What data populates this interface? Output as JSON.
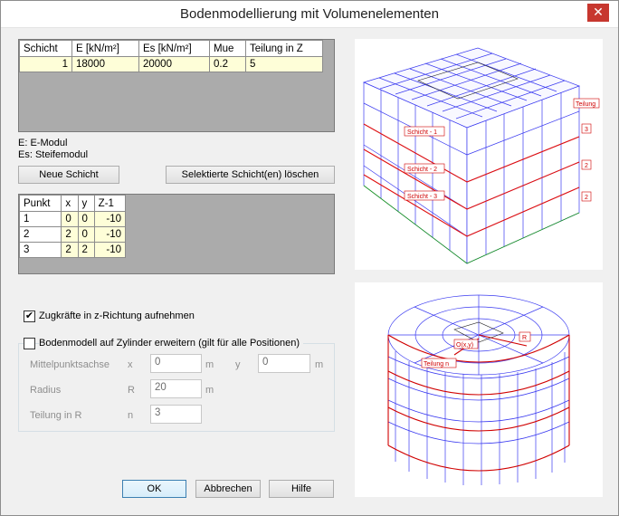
{
  "dialog": {
    "title": "Bodenmodellierung mit Volumenelementen",
    "close": "✕"
  },
  "layers": {
    "headers": [
      "Schicht",
      "E [kN/m²]",
      "Es [kN/m²]",
      "Mue",
      "Teilung in Z"
    ],
    "rows": [
      [
        "1",
        "18000",
        "20000",
        "0.2",
        "5"
      ]
    ]
  },
  "legend": {
    "e": "E: E-Modul",
    "es": "Es: Steifemodul"
  },
  "buttons": {
    "new_layer": "Neue Schicht",
    "delete_layer": "Selektierte Schicht(en)  löschen",
    "ok": "OK",
    "cancel": "Abbrechen",
    "help": "Hilfe"
  },
  "points": {
    "headers": [
      "Punkt",
      "x",
      "y",
      "Z-1"
    ],
    "rows": [
      [
        "1",
        "0",
        "0",
        "-10"
      ],
      [
        "2",
        "2",
        "0",
        "-10"
      ],
      [
        "3",
        "2",
        "2",
        "-10"
      ]
    ]
  },
  "options": {
    "tension_label": "Zugkräfte in z-Richtung aufnehmen",
    "tension_checked": true,
    "cylinder_label": "Bodenmodell auf Zylinder erweitern (gilt für alle Positionen)",
    "cylinder_checked": false
  },
  "cylinder": {
    "center_label": "Mittelpunktsachse",
    "x_label": "x",
    "x_value": "0",
    "x_unit": "m",
    "y_label": "y",
    "y_value": "0",
    "y_unit": "m",
    "radius_label": "Radius",
    "r_label": "R",
    "r_value": "20",
    "r_unit": "m",
    "div_label": "Teilung in R",
    "n_label": "n",
    "n_value": "3"
  },
  "preview_top": {
    "schicht1": "Schicht - 1",
    "schicht2": "Schicht - 2",
    "schicht3": "Schicht - 3",
    "teilung": "Teilung",
    "div1": "3",
    "div2": "2",
    "div3": "2"
  },
  "preview_bottom": {
    "center": "O(x,y)",
    "radius": "R",
    "teilung_n": "Teilung n"
  }
}
